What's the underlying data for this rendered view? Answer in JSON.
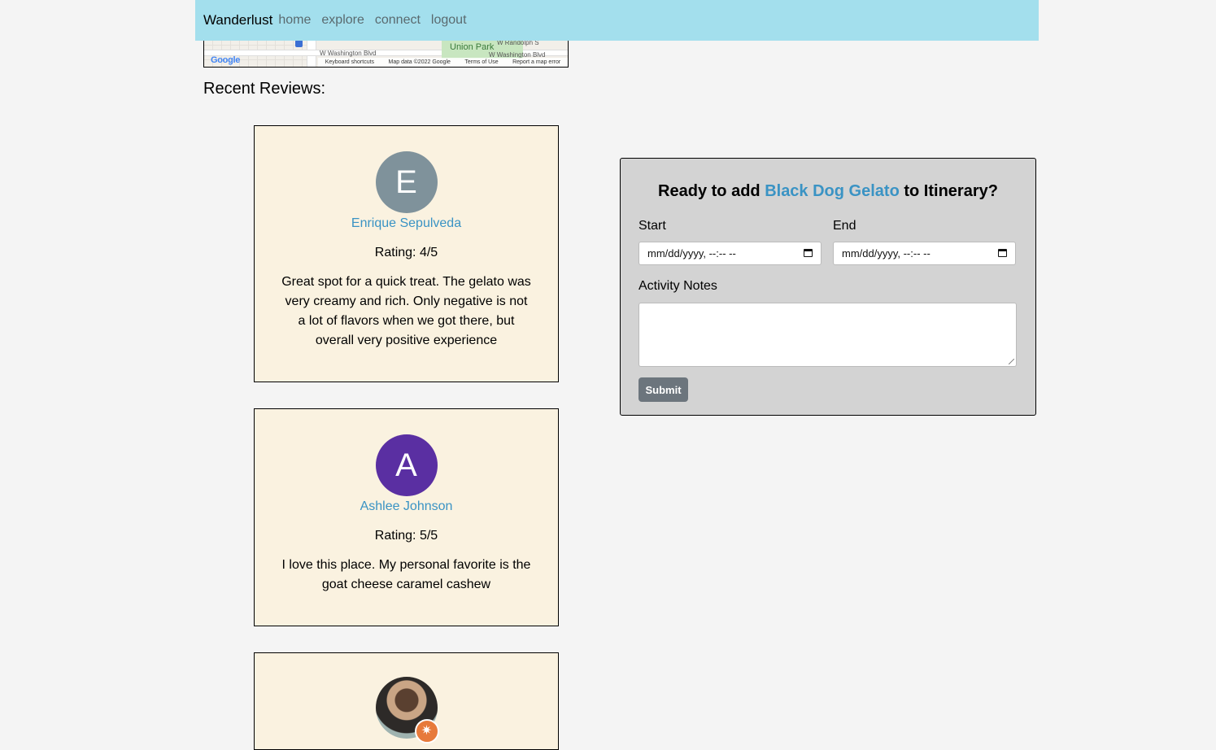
{
  "navbar": {
    "brand": "Wanderlust",
    "links": [
      "home",
      "explore",
      "connect",
      "logout"
    ]
  },
  "map": {
    "park_label": "Union Park",
    "street_labels": [
      "W Washington Blvd",
      "W Washington Blvd",
      "W Randolph S"
    ],
    "footer": [
      "Keyboard shortcuts",
      "Map data ©2022 Google",
      "Terms of Use",
      "Report a map error"
    ],
    "logo": "Google"
  },
  "reviews_section": {
    "title": "Recent Reviews:",
    "reviews": [
      {
        "initial": "E",
        "avatar_color": "#7f929b",
        "name": "Enrique Sepulveda",
        "rating": "Rating: 4/5",
        "text": "Great spot for a quick treat. The gelato was very creamy and rich. Only negative is not a lot of flavors when we got there, but overall very positive experience"
      },
      {
        "initial": "A",
        "avatar_color": "#5a2fa2",
        "name": "Ashlee Johnson",
        "rating": "Rating: 5/5",
        "text": "I love this place. My personal favorite is the goat cheese caramel cashew"
      },
      {
        "avatar_type": "photo",
        "badge_icon": "star-icon"
      }
    ]
  },
  "itinerary_form": {
    "title_prefix": "Ready to add",
    "place_name": "Black Dog Gelato",
    "title_suffix": "to Itinerary?",
    "start_label": "Start",
    "end_label": "End",
    "start_value": "mm/dd/yyyy, --:-- --",
    "end_value": "mm/dd/yyyy, --:-- --",
    "notes_label": "Activity Notes",
    "notes_value": "",
    "submit_label": "Submit"
  },
  "colors": {
    "navbar_bg": "#a3dfed",
    "link_accent": "#3a93c4",
    "card_bg": "#faf2e0",
    "form_bg": "#d3d3d3",
    "submit_bg": "#6c757d"
  }
}
